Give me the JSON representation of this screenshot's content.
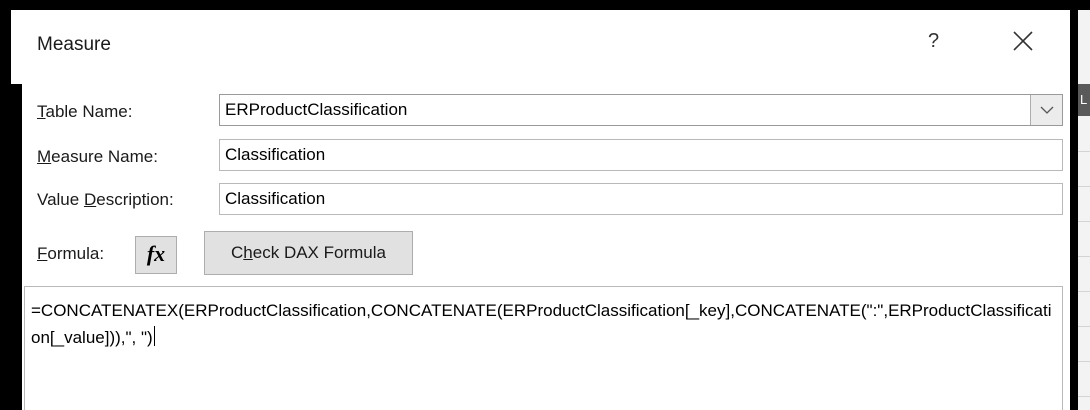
{
  "dialog": {
    "title": "Measure",
    "help_label": "?",
    "close_label": "×"
  },
  "form": {
    "table_name": {
      "label_prefix": "",
      "label_hotkey": "T",
      "label_rest": "able Name:",
      "value": "ERProductClassification"
    },
    "measure_name": {
      "label_prefix": "",
      "label_hotkey": "M",
      "label_rest": "easure Name:",
      "value": "Classification"
    },
    "value_description": {
      "label_prefix": "Value ",
      "label_hotkey": "D",
      "label_rest": "escription:",
      "value": "Classification"
    },
    "formula": {
      "label_prefix": "",
      "label_hotkey": "F",
      "label_rest": "ormula:",
      "fx_label": "fx",
      "check_prefix": "C",
      "check_hotkey": "h",
      "check_rest": "eck DAX Formula",
      "value": "=CONCATENATEX(ERProductClassification,CONCATENATE(ERProductClassification[_key],CONCATENATE(\":\",ERProductClassification[_value])),\", \")"
    }
  },
  "background": {
    "column_header": "L"
  },
  "icons": {
    "dropdown": "chevron-down-icon",
    "close": "close-icon",
    "help": "help-icon",
    "function": "function-icon"
  }
}
